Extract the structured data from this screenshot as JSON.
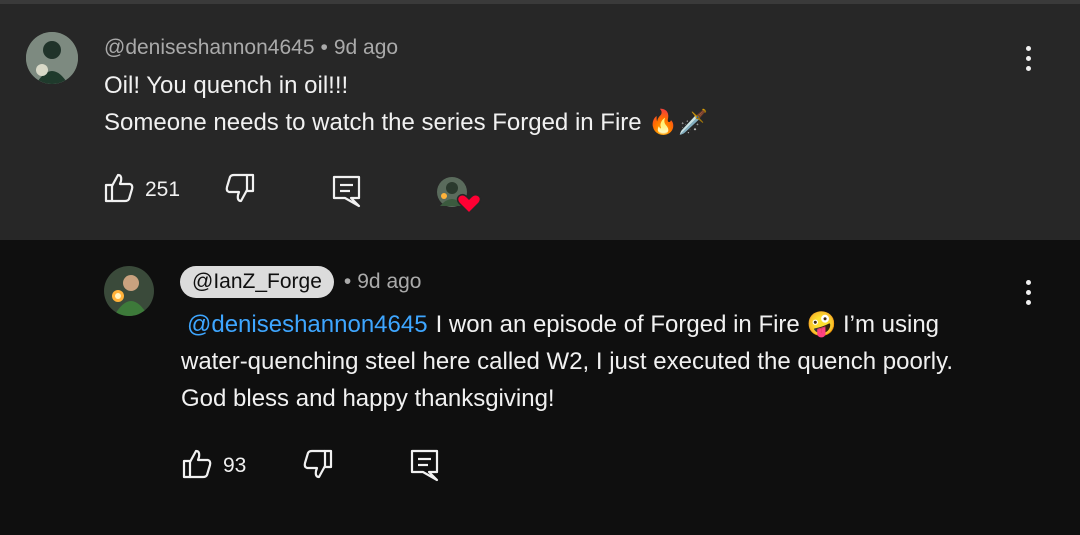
{
  "comments": [
    {
      "author": "@deniseshannon4645",
      "time": "9d ago",
      "lines": [
        "Oil! You quench in oil!!!",
        "Someone needs to watch the series Forged in Fire 🔥🗡️"
      ],
      "likes": "251",
      "creator_heart": true
    },
    {
      "author": "@IanZ_Forge",
      "time": "9d ago",
      "mention": "@deniseshannon4645",
      "lines": [
        "I won an episode of Forged in Fire 🤪 I’m using",
        "water-quenching steel here called W2, I just executed the quench poorly.",
        "God bless and happy thanksgiving!"
      ],
      "likes": "93"
    }
  ],
  "icons": [
    "like-icon",
    "dislike-icon",
    "reply-icon",
    "more-icon",
    "heart-icon"
  ],
  "colors": {
    "top_bg": "#272727",
    "reply_bg": "#0f0f0f",
    "mention": "#3ea6ff",
    "heart": "#ff0033"
  }
}
